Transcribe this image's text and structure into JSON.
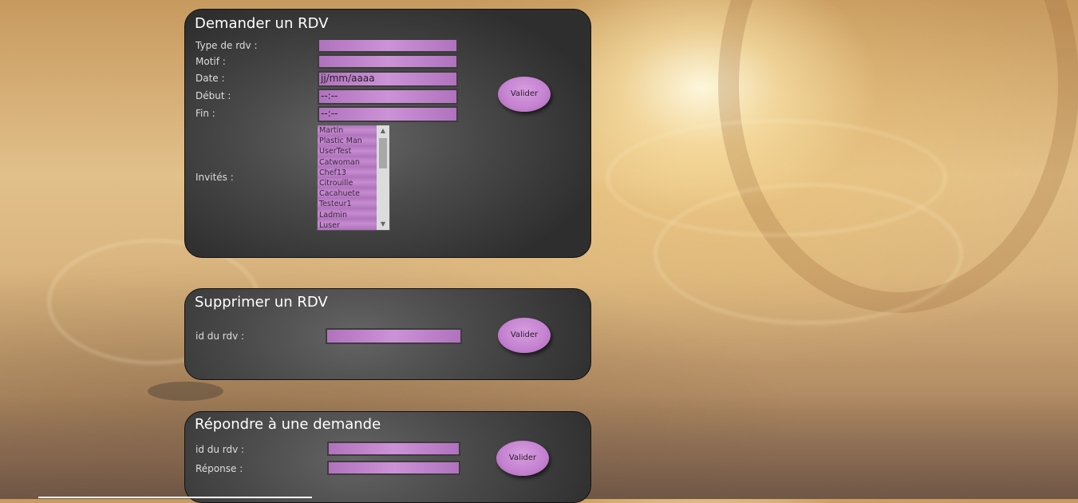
{
  "demander": {
    "title": "Demander un RDV",
    "labels": {
      "type": "Type de rdv :",
      "motif": "Motif :",
      "date": "Date :",
      "debut": "Début :",
      "fin": "Fin :",
      "invites": "Invités :"
    },
    "values": {
      "type": "",
      "motif": "",
      "date": "jj/mm/aaaa",
      "debut": "--:--",
      "fin": "--:--"
    },
    "invites": [
      "Martin",
      "Plastic Man",
      "UserTest",
      "Catwoman",
      "Chef13",
      "Citrouille",
      "Cacahuete",
      "Testeur1",
      "Ladmin",
      "Luser"
    ],
    "button": "Valider"
  },
  "supprimer": {
    "title": "Supprimer un RDV",
    "labels": {
      "id": "id du rdv :"
    },
    "values": {
      "id": ""
    },
    "button": "Valider"
  },
  "repondre": {
    "title": "Répondre à une demande",
    "labels": {
      "id": "id du rdv :",
      "reponse": "Réponse :"
    },
    "values": {
      "id": "",
      "reponse": ""
    },
    "button": "Valider"
  },
  "colors": {
    "field": "#c48ad0",
    "button": "#c481d0",
    "panel": "#3a3a3a"
  }
}
